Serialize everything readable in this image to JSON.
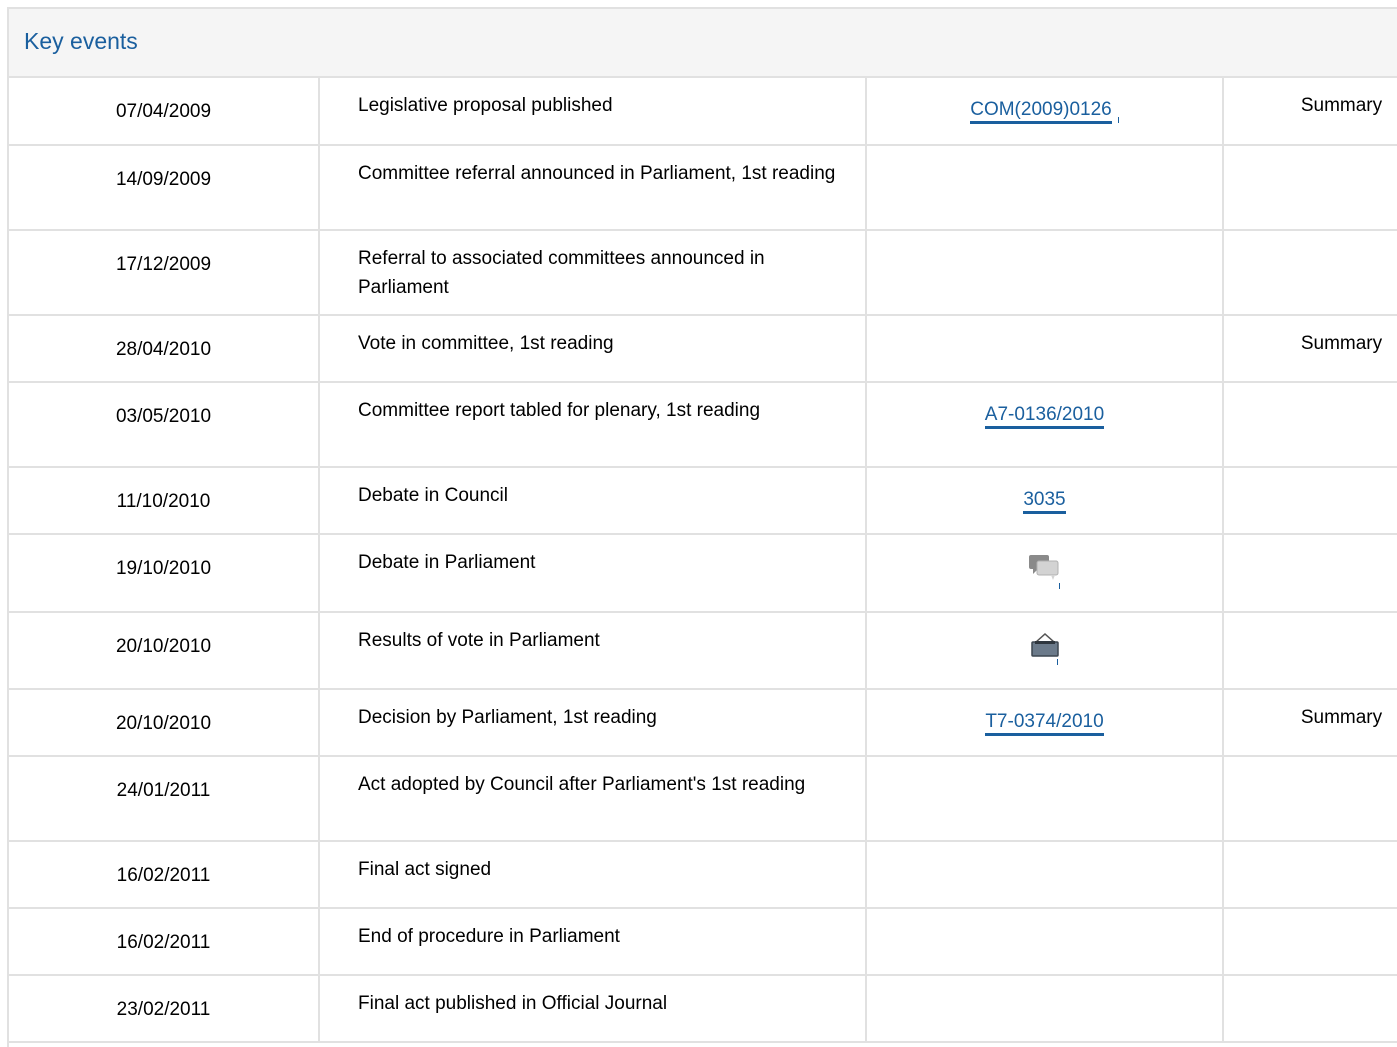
{
  "header": {
    "title": "Key events"
  },
  "events": [
    {
      "date": "07/04/2009",
      "event": "Legislative proposal published",
      "doc": "COM(2009)0126",
      "summary": "Summary"
    },
    {
      "date": "14/09/2009",
      "event": "Committee referral announced in Parliament, 1st reading",
      "doc": "",
      "summary": ""
    },
    {
      "date": "17/12/2009",
      "event": "Referral to associated committees announced in Parliament",
      "doc": "",
      "summary": ""
    },
    {
      "date": "28/04/2010",
      "event": "Vote in committee, 1st reading",
      "doc": "",
      "summary": "Summary"
    },
    {
      "date": "03/05/2010",
      "event": "Committee report tabled for plenary, 1st reading",
      "doc": "A7-0136/2010",
      "summary": ""
    },
    {
      "date": "11/10/2010",
      "event": "Debate in Council",
      "doc": "3035",
      "summary": ""
    },
    {
      "date": "19/10/2010",
      "event": "Debate in Parliament",
      "icon": "debate-speech-bubbles-icon",
      "summary": ""
    },
    {
      "date": "20/10/2010",
      "event": "Results of vote in Parliament",
      "icon": "ballot-box-vote-icon",
      "summary": ""
    },
    {
      "date": "20/10/2010",
      "event": "Decision by Parliament, 1st reading",
      "doc": "T7-0374/2010",
      "summary": "Summary"
    },
    {
      "date": "24/01/2011",
      "event": "Act adopted by Council after Parliament's 1st reading",
      "doc": "",
      "summary": ""
    },
    {
      "date": "16/02/2011",
      "event": "Final act signed",
      "doc": "",
      "summary": ""
    },
    {
      "date": "16/02/2011",
      "event": "End of procedure in Parliament",
      "doc": "",
      "summary": ""
    },
    {
      "date": "23/02/2011",
      "event": "Final act published in Official Journal",
      "doc": "",
      "summary": ""
    }
  ],
  "colors": {
    "accent": "#1a5f9e",
    "border": "#e1e1e1",
    "header_bg": "#f5f5f5"
  }
}
